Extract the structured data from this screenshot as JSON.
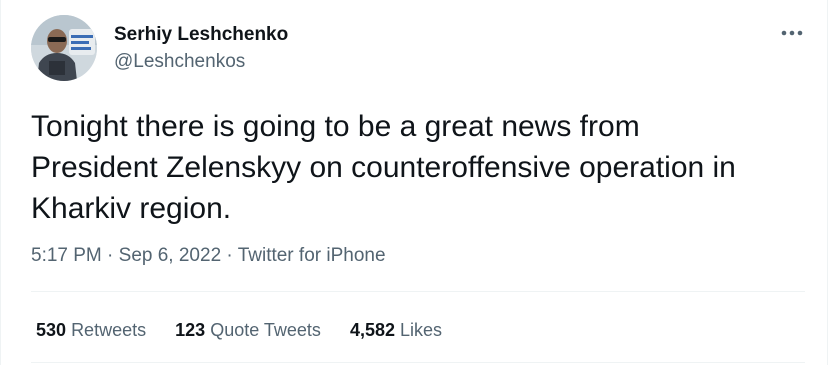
{
  "author": {
    "display_name": "Serhiy Leshchenko",
    "handle": "@Leshchenkos"
  },
  "tweet": {
    "text": "Tonight there is going to be a great news from\nPresident Zelenskyy on counteroffensive operation in\nKharkiv region."
  },
  "meta": {
    "time": "5:17 PM",
    "separator": "·",
    "date": "Sep 6, 2022",
    "source": "Twitter for iPhone"
  },
  "stats": {
    "retweets_count": "530",
    "retweets_label": "Retweets",
    "quotes_count": "123",
    "quotes_label": "Quote Tweets",
    "likes_count": "4,582",
    "likes_label": "Likes"
  },
  "icons": {
    "more": "more-dots-icon"
  },
  "colors": {
    "text_primary": "#0f1419",
    "text_secondary": "#536471",
    "divider": "#eff3f4"
  }
}
